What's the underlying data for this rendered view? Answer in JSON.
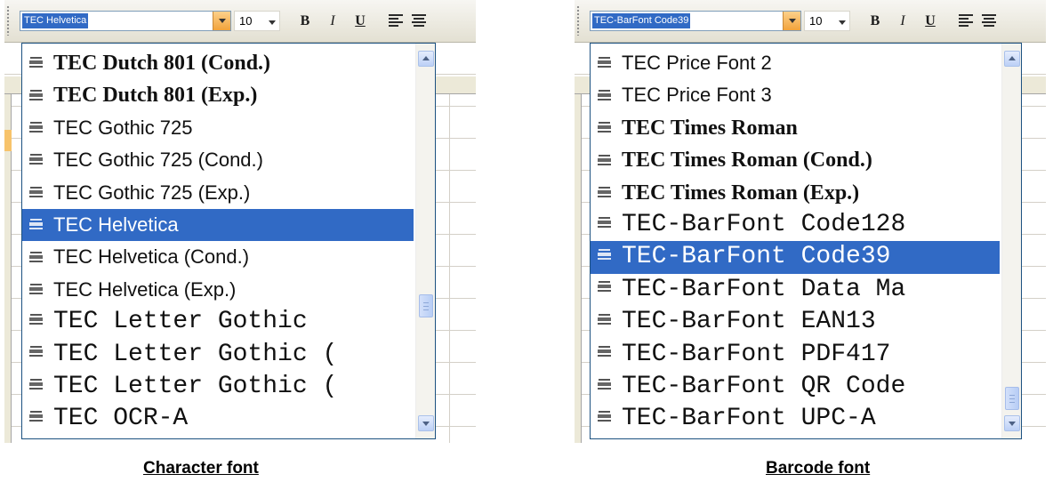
{
  "character_panel": {
    "font_box_value": "TEC Helvetica",
    "size_value": "10",
    "toolbar": {
      "bold_label": "B",
      "italic_label": "I",
      "underline_label": "U"
    },
    "items": [
      {
        "label": "TEC Dutch 801 (Cond.)",
        "style": "serif",
        "selected": false
      },
      {
        "label": "TEC Dutch 801 (Exp.)",
        "style": "serif",
        "selected": false
      },
      {
        "label": "TEC Gothic 725",
        "style": "sans",
        "selected": false
      },
      {
        "label": "TEC Gothic 725 (Cond.)",
        "style": "sans",
        "selected": false
      },
      {
        "label": "TEC Gothic 725 (Exp.)",
        "style": "sans",
        "selected": false
      },
      {
        "label": "TEC Helvetica",
        "style": "sans",
        "selected": true
      },
      {
        "label": "TEC Helvetica (Cond.)",
        "style": "sans",
        "selected": false
      },
      {
        "label": "TEC Helvetica (Exp.)",
        "style": "sans",
        "selected": false
      },
      {
        "label": "TEC Letter Gothic",
        "style": "mono",
        "selected": false
      },
      {
        "label": "TEC Letter Gothic (",
        "style": "mono",
        "selected": false
      },
      {
        "label": "TEC Letter Gothic (",
        "style": "mono",
        "selected": false
      },
      {
        "label": "TEC OCR-A",
        "style": "mono",
        "selected": false
      }
    ],
    "caption": "Character font"
  },
  "barcode_panel": {
    "font_box_value": "TEC-BarFont Code39",
    "size_value": "10",
    "toolbar": {
      "bold_label": "B",
      "italic_label": "I",
      "underline_label": "U"
    },
    "items": [
      {
        "label": "TEC Price Font 2",
        "style": "sans",
        "selected": false
      },
      {
        "label": "TEC Price Font 3",
        "style": "sans",
        "selected": false
      },
      {
        "label": "TEC Times Roman",
        "style": "serif",
        "selected": false
      },
      {
        "label": "TEC Times Roman (Cond.)",
        "style": "serif",
        "selected": false
      },
      {
        "label": "TEC Times Roman (Exp.)",
        "style": "serif",
        "selected": false
      },
      {
        "label": "TEC-BarFont Code128",
        "style": "mono",
        "selected": false
      },
      {
        "label": "TEC-BarFont Code39",
        "style": "mono",
        "selected": true
      },
      {
        "label": "TEC-BarFont Data Ma",
        "style": "mono",
        "selected": false
      },
      {
        "label": "TEC-BarFont EAN13",
        "style": "mono",
        "selected": false
      },
      {
        "label": "TEC-BarFont PDF417",
        "style": "mono",
        "selected": false
      },
      {
        "label": "TEC-BarFont QR Code",
        "style": "mono",
        "selected": false
      },
      {
        "label": "TEC-BarFont UPC-A",
        "style": "mono",
        "selected": false
      }
    ],
    "caption": "Barcode font"
  },
  "colors": {
    "selection": "#316ac5",
    "combo_arrow": "#f2a33b",
    "toolbar": "#ece9d8"
  },
  "icons": {
    "font_item": "printer-font-icon",
    "align": "align-left-icon"
  }
}
